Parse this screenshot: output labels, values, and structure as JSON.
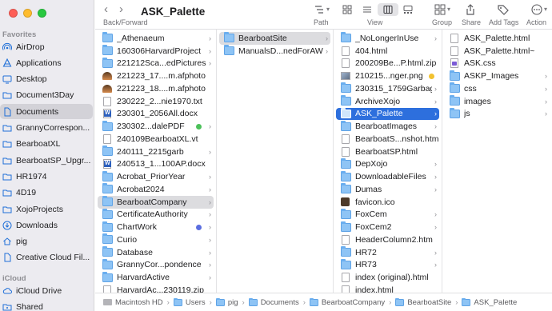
{
  "window": {
    "title": "ASK_Palette"
  },
  "toolbar": {
    "back_forward_label": "Back/Forward",
    "path_label": "Path",
    "view_label": "View",
    "group_label": "Group",
    "share_label": "Share",
    "add_tags_label": "Add Tags",
    "action_label": "Action",
    "back_glyph": "‹",
    "forward_glyph": "›"
  },
  "sidebar": {
    "favorites_header": "Favorites",
    "favorites": [
      {
        "label": "AirDrop",
        "icon": "airdrop-icon"
      },
      {
        "label": "Applications",
        "icon": "applications-icon"
      },
      {
        "label": "Desktop",
        "icon": "desktop-icon"
      },
      {
        "label": "Document3Day",
        "icon": "folder-icon"
      },
      {
        "label": "Documents",
        "icon": "documents-icon",
        "selected": true
      },
      {
        "label": "GrannyCorrespon...",
        "icon": "folder-icon"
      },
      {
        "label": "BearboatXL",
        "icon": "folder-icon"
      },
      {
        "label": "BearboatSP_Upgr...",
        "icon": "folder-icon"
      },
      {
        "label": "HR1974",
        "icon": "folder-icon"
      },
      {
        "label": "4D19",
        "icon": "folder-icon"
      },
      {
        "label": "XojoProjects",
        "icon": "folder-icon"
      },
      {
        "label": "Downloads",
        "icon": "downloads-icon"
      },
      {
        "label": "pig",
        "icon": "home-icon"
      },
      {
        "label": "Creative Cloud Fil...",
        "icon": "document-icon"
      }
    ],
    "icloud_header": "iCloud",
    "icloud": [
      {
        "label": "iCloud Drive",
        "icon": "cloud-icon"
      },
      {
        "label": "Shared",
        "icon": "shared-folder-icon"
      }
    ]
  },
  "columns": [
    {
      "items": [
        {
          "label": "_Athenaeum",
          "type": "folder",
          "chevron": true
        },
        {
          "label": "160306HarvardProject",
          "type": "folder",
          "chevron": true
        },
        {
          "label": "221212Sca...edPictures",
          "type": "folder",
          "chevron": true
        },
        {
          "label": "221223_17....m.afphoto",
          "type": "photo"
        },
        {
          "label": "221223_18....m.afphoto",
          "type": "photo"
        },
        {
          "label": "230222_2...nie1970.txt",
          "type": "doc"
        },
        {
          "label": "230301_2056All.docx",
          "type": "word"
        },
        {
          "label": "230302...dalePDF",
          "type": "folder",
          "tag": "#4cc15a",
          "chevron": true
        },
        {
          "label": "240109BearboatXL.vt",
          "type": "doc"
        },
        {
          "label": "240111_2215garb",
          "type": "folder",
          "chevron": true
        },
        {
          "label": "240513_1...100AP.docx",
          "type": "word"
        },
        {
          "label": "Acrobat_PriorYear",
          "type": "folder",
          "chevron": true
        },
        {
          "label": "Acrobat2024",
          "type": "folder",
          "chevron": true
        },
        {
          "label": "BearboatCompany",
          "type": "folder",
          "chevron": true,
          "selection": "inactive"
        },
        {
          "label": "CertificateAuthority",
          "type": "folder",
          "chevron": true
        },
        {
          "label": "ChartWork",
          "type": "folder",
          "tag": "#5b6ee0",
          "chevron": true
        },
        {
          "label": "Curio",
          "type": "folder",
          "chevron": true
        },
        {
          "label": "Database",
          "type": "folder",
          "chevron": true
        },
        {
          "label": "GrannyCor...pondence",
          "type": "folder",
          "chevron": true
        },
        {
          "label": "HarvardActive",
          "type": "folder",
          "chevron": true
        },
        {
          "label": "HarvardAc...230119.zip",
          "type": "doc"
        }
      ]
    },
    {
      "items": [
        {
          "label": "BearboatSite",
          "type": "folder",
          "chevron": true,
          "selection": "inactive"
        },
        {
          "label": "ManualsD...nedForAWS",
          "type": "folder",
          "chevron": true
        }
      ]
    },
    {
      "items": [
        {
          "label": "_NoLongerInUse",
          "type": "folder",
          "chevron": true
        },
        {
          "label": "404.html",
          "type": "doc"
        },
        {
          "label": "200209Be...P.html.zip",
          "type": "doc"
        },
        {
          "label": "210215...nger.png",
          "type": "img",
          "tag": "#f2c230"
        },
        {
          "label": "230315_1759Garbage",
          "type": "folder",
          "chevron": true
        },
        {
          "label": "ArchiveXojo",
          "type": "folder",
          "chevron": true
        },
        {
          "label": "ASK_Palette",
          "type": "folder",
          "chevron": true,
          "selection": "active"
        },
        {
          "label": "BearboatImages",
          "type": "folder",
          "chevron": true
        },
        {
          "label": "BearboatS...nshot.html",
          "type": "doc"
        },
        {
          "label": "BearboatSP.html",
          "type": "doc"
        },
        {
          "label": "DepXojo",
          "type": "folder",
          "chevron": true
        },
        {
          "label": "DownloadableFiles",
          "type": "folder",
          "chevron": true
        },
        {
          "label": "Dumas",
          "type": "folder",
          "chevron": true
        },
        {
          "label": "favicon.ico",
          "type": "fav"
        },
        {
          "label": "FoxCem",
          "type": "folder",
          "chevron": true
        },
        {
          "label": "FoxCem2",
          "type": "folder",
          "chevron": true
        },
        {
          "label": "HeaderColumn2.htm",
          "type": "doc"
        },
        {
          "label": "HR72",
          "type": "folder",
          "chevron": true
        },
        {
          "label": "HR73",
          "type": "folder",
          "chevron": true
        },
        {
          "label": "index (original).html",
          "type": "doc"
        },
        {
          "label": "index.html",
          "type": "doc"
        }
      ]
    },
    {
      "items": [
        {
          "label": "ASK_Palette.html",
          "type": "doc"
        },
        {
          "label": "ASK_Palette.html~",
          "type": "doc"
        },
        {
          "label": "ASK.css",
          "type": "css"
        },
        {
          "label": "ASKP_Images",
          "type": "folder",
          "chevron": true
        },
        {
          "label": "css",
          "type": "folder",
          "chevron": true
        },
        {
          "label": "images",
          "type": "folder",
          "chevron": true
        },
        {
          "label": "js",
          "type": "folder",
          "chevron": true
        }
      ]
    }
  ],
  "pathbar": {
    "crumbs": [
      "Macintosh HD",
      "Users",
      "pig",
      "Documents",
      "BearboatCompany",
      "BearboatSite",
      "ASK_Palette"
    ],
    "separator": "›"
  },
  "colors": {
    "accent": "#2d6fdd",
    "sidebar_bg": "#ecebf0",
    "selection_inactive": "#dcdcdf"
  }
}
